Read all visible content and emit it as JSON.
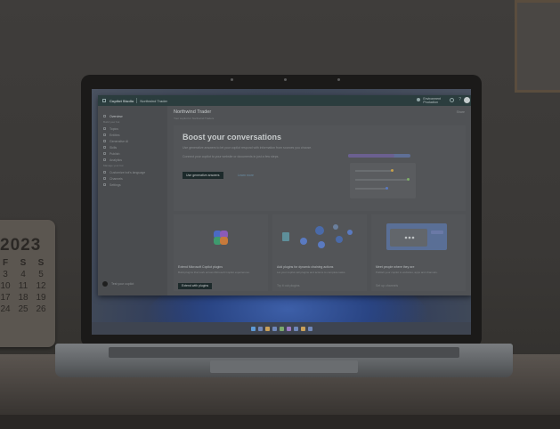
{
  "scene": {
    "calendar": {
      "year": "2023",
      "weekday_headers": [
        "F",
        "S",
        "S"
      ],
      "rows": [
        [
          "3",
          "4",
          "5"
        ],
        [
          "10",
          "11",
          "12"
        ],
        [
          "17",
          "18",
          "19"
        ],
        [
          "24",
          "25",
          "26"
        ]
      ]
    }
  },
  "app": {
    "name": "Copilot Studio",
    "breadcrumb": "Northwind Trader",
    "environment_label": "Environment",
    "environment_value": "Production",
    "help_glyph": "?"
  },
  "sidebar": {
    "items": [
      {
        "label": "Overview",
        "active": true
      },
      {
        "label": "Build your bot",
        "section": true
      },
      {
        "label": "Topics"
      },
      {
        "label": "Entities"
      },
      {
        "label": "Generative AI"
      },
      {
        "label": "Skills"
      },
      {
        "label": "Publish"
      },
      {
        "label": "Analytics"
      },
      {
        "label": "Manage your bot",
        "section": true
      },
      {
        "label": "Customize bot's language"
      },
      {
        "label": "Channels"
      },
      {
        "label": "Settings"
      }
    ],
    "footer": "Test your copilot"
  },
  "main": {
    "title": "Northwind Trader",
    "subtitle": "Your copilot for Northwind Traders",
    "top_action": "Share",
    "boost": {
      "title": "Boost your conversations",
      "description": "Use generative answers to let your copilot respond with information from sources you choose.",
      "description2": "Connect your copilot to your website or documents in just a few steps.",
      "primary_button": "Use generative answers",
      "secondary_link": "Learn more"
    },
    "cards": [
      {
        "title": "Extend Microsoft Copilot plugins",
        "text": "Build plugins that work across Microsoft Copilot experiences.",
        "button": "Extend with plugins"
      },
      {
        "title": "Add plugins for dynamic chaining actions",
        "text": "Let your copilot call plugins and actions to complete tasks.",
        "link": "Try it out plugins"
      },
      {
        "title": "Meet people where they are",
        "text": "Publish your copilot to websites, apps and channels.",
        "link": "Set up channels"
      }
    ]
  },
  "colors": {
    "titlebar": "#2b3d3e",
    "primary_button": "#1d2a2b",
    "link": "#6a8fa8"
  }
}
